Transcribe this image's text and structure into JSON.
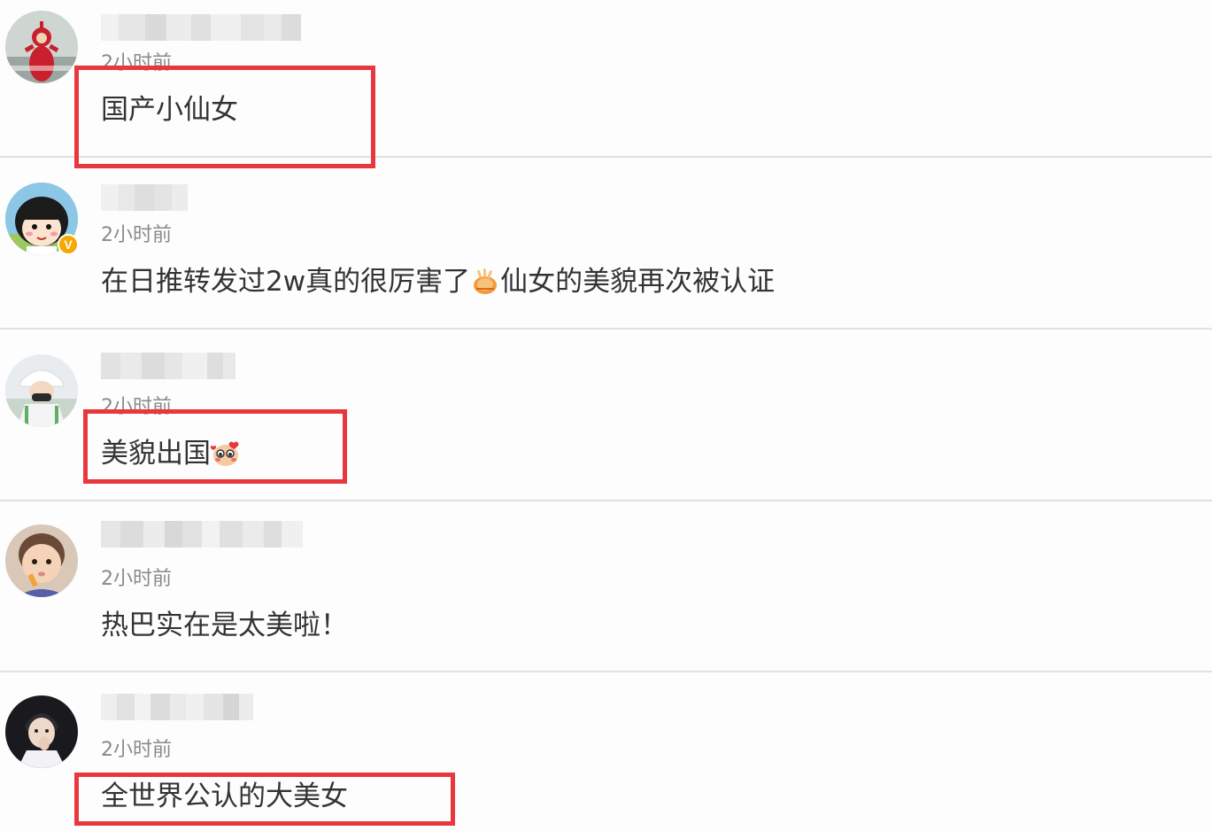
{
  "comments": [
    {
      "time": "2小时前",
      "text": "国产小仙女",
      "verified": false,
      "avatar": "teletubby-avatar"
    },
    {
      "time": "2小时前",
      "text_before_emoji": "在日推转发过2w真的很厉害了",
      "text_after_emoji": "仙女的美貌再次被认证",
      "emoji": "clapping-hands-emoji",
      "verified": true,
      "verified_label": "V",
      "avatar": "cartoon-girl-avatar"
    },
    {
      "time": "2小时前",
      "text": "美貌出国",
      "emoji": "blushing-cartoon-emoji",
      "verified": false,
      "avatar": "person-white-hat-avatar"
    },
    {
      "time": "2小时前",
      "text": "热巴实在是太美啦！",
      "verified": false,
      "avatar": "baby-avatar"
    },
    {
      "time": "2小时前",
      "text": "全世界公认的大美女",
      "verified": false,
      "avatar": "young-man-avatar"
    }
  ],
  "colors": {
    "highlight": "#e8383d",
    "verified_badge": "#f6a800",
    "time_text": "#8a8a8a",
    "body_text": "#333333",
    "divider": "#e1e1e1"
  }
}
